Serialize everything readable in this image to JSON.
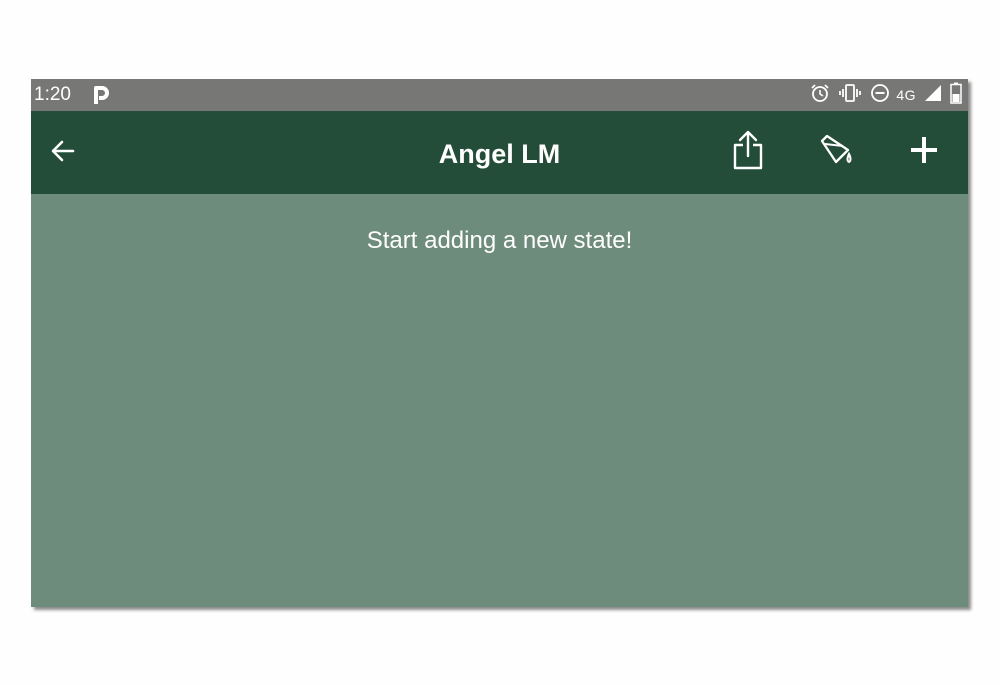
{
  "status_bar": {
    "time": "1:20",
    "network": "4G",
    "icons": [
      "parking-app-icon",
      "alarm-icon",
      "vibrate-icon",
      "do-not-disturb-icon",
      "signal-icon",
      "battery-icon"
    ]
  },
  "app_bar": {
    "title": "Angel LM",
    "actions": [
      "back-arrow-icon",
      "share-icon",
      "paint-bucket-icon",
      "plus-icon"
    ]
  },
  "content": {
    "empty_message": "Start adding a new state!"
  },
  "colors": {
    "status_bar": "#777876",
    "app_bar": "#234d38",
    "content_background": "#6e8c7c",
    "text": "#ffffff"
  }
}
